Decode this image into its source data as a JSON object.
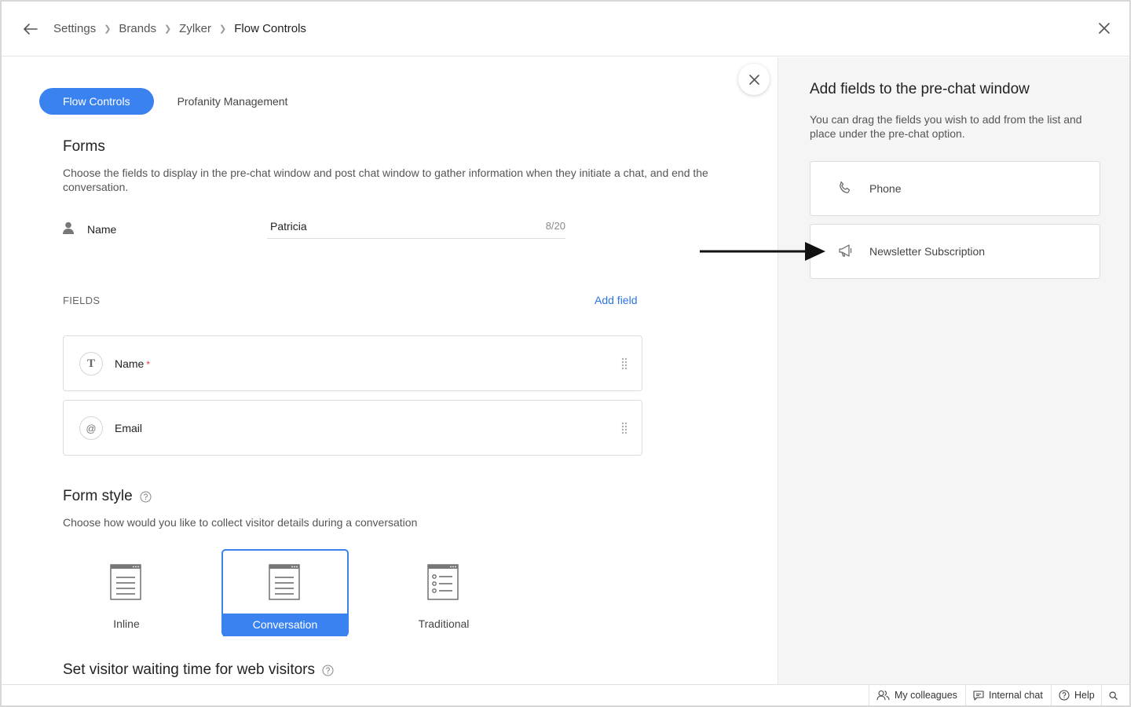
{
  "breadcrumb": {
    "items": [
      "Settings",
      "Brands",
      "Zylker"
    ],
    "current": "Flow Controls"
  },
  "tabs": {
    "active": "Flow Controls",
    "other": "Profanity Management"
  },
  "forms": {
    "title": "Forms",
    "description": "Choose the fields to display in the pre-chat window and post chat window to gather information when they initiate a chat, and end the conversation.",
    "name_label": "Name",
    "name_value": "Patricia",
    "name_count": "8/20"
  },
  "fields": {
    "label": "FIELDS",
    "add_label": "Add field",
    "items": [
      {
        "label": "Name",
        "required": "*",
        "icon": "text-icon"
      },
      {
        "label": "Email",
        "required": "",
        "icon": "at-icon"
      }
    ]
  },
  "form_style": {
    "title": "Form style",
    "description": "Choose how would you like to collect visitor details during a conversation",
    "options": [
      "Inline",
      "Conversation",
      "Traditional"
    ],
    "selected": "Conversation"
  },
  "waiting": {
    "title": "Set visitor waiting time for web visitors"
  },
  "panel": {
    "title": "Add fields to the pre-chat window",
    "description": "You can drag the fields you wish to add from the list and place under the pre-chat option.",
    "items": [
      {
        "label": "Phone",
        "icon": "phone-icon"
      },
      {
        "label": "Newsletter Subscription",
        "icon": "megaphone-icon"
      }
    ]
  },
  "footer": {
    "colleagues": "My colleagues",
    "internal_chat": "Internal chat",
    "help": "Help"
  },
  "colors": {
    "accent": "#3a82f0",
    "link": "#2a73e8",
    "required": "#e53935"
  }
}
